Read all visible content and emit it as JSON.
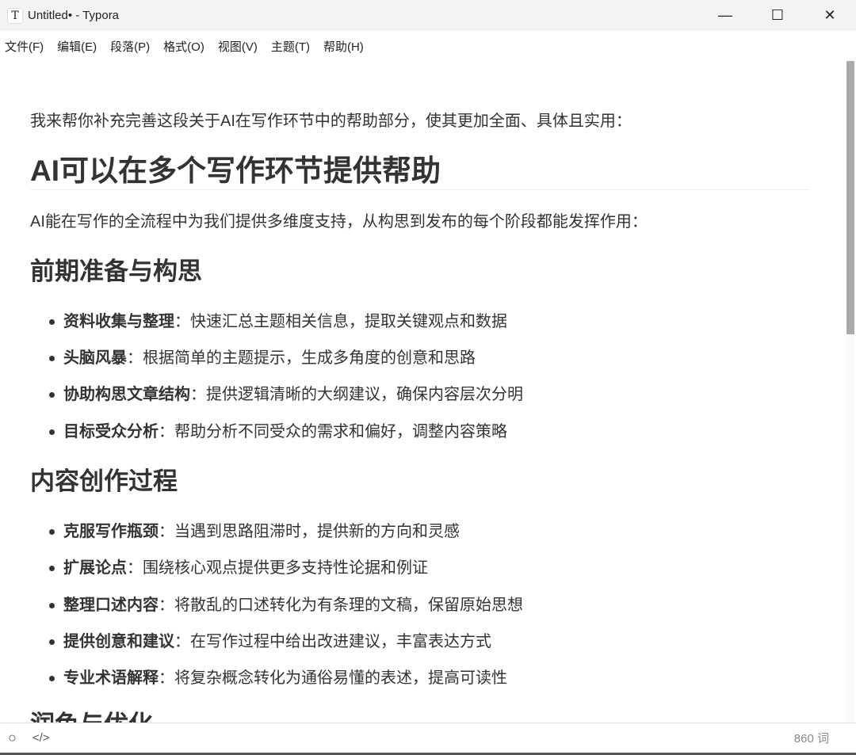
{
  "window": {
    "title": "Untitled• - Typora",
    "app_icon": "T",
    "buttons": {
      "minimize": "—",
      "maximize": "☐",
      "close": "✕"
    }
  },
  "menu": [
    "文件(F)",
    "编辑(E)",
    "段落(P)",
    "格式(O)",
    "视图(V)",
    "主题(T)",
    "帮助(H)"
  ],
  "doc": {
    "intro": "我来帮你补充完善这段关于AI在写作环节中的帮助部分，使其更加全面、具体且实用：",
    "h1": "AI可以在多个写作环节提供帮助",
    "p1": "AI能在写作的全流程中为我们提供多维度支持，从构思到发布的每个阶段都能发挥作用：",
    "sections": [
      {
        "title": "前期准备与构思",
        "items": [
          {
            "bold": "资料收集与整理",
            "text": "：快速汇总主题相关信息，提取关键观点和数据"
          },
          {
            "bold": "头脑风暴",
            "text": "：根据简单的主题提示，生成多角度的创意和思路"
          },
          {
            "bold": "协助构思文章结构",
            "text": "：提供逻辑清晰的大纲建议，确保内容层次分明"
          },
          {
            "bold": "目标受众分析",
            "text": "：帮助分析不同受众的需求和偏好，调整内容策略"
          }
        ]
      },
      {
        "title": "内容创作过程",
        "items": [
          {
            "bold": "克服写作瓶颈",
            "text": "：当遇到思路阻滞时，提供新的方向和灵感"
          },
          {
            "bold": "扩展论点",
            "text": "：围绕核心观点提供更多支持性论据和例证"
          },
          {
            "bold": "整理口述内容",
            "text": "：将散乱的口述转化为有条理的文稿，保留原始思想"
          },
          {
            "bold": "提供创意和建议",
            "text": "：在写作过程中给出改进建议，丰富表达方式"
          },
          {
            "bold": "专业术语解释",
            "text": "：将复杂概念转化为通俗易懂的表述，提高可读性"
          }
        ]
      },
      {
        "title": "润色与优化",
        "items": []
      }
    ]
  },
  "status": {
    "circle_icon": "○",
    "source_icon": "</>",
    "word_count": "860 词"
  }
}
